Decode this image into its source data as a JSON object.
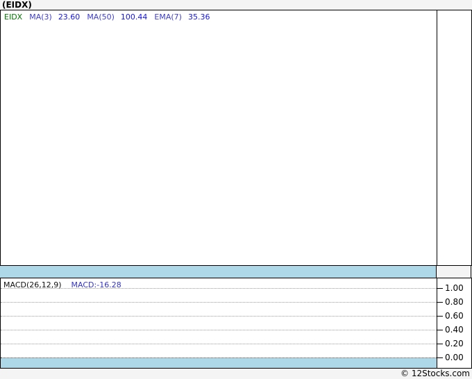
{
  "page": {
    "title": "(EIDX)",
    "footer_credit": "© 12Stocks.com"
  },
  "colors": {
    "background": "#f4f4f4",
    "panel_background": "#ffffff",
    "border": "#000000",
    "band_blue": "#aed7e8",
    "symbol_green": "#007700",
    "indicator_label_blue": "#3d3dcc",
    "indicator_value_blue": "#1414e6",
    "macd_value_blue": "#3333cc",
    "gridline_gray": "#999999"
  },
  "price_panel": {
    "legend": {
      "symbol": "EIDX",
      "indicators": [
        {
          "label": "MA(3)",
          "value": "23.60"
        },
        {
          "label": "MA(50)",
          "value": "100.44"
        },
        {
          "label": "EMA(7)",
          "value": "35.36"
        }
      ]
    }
  },
  "macd_panel": {
    "label": "MACD(26,12,9)",
    "value": "MACD:-16.28",
    "yticks": [
      "1.00",
      "0.80",
      "0.60",
      "0.40",
      "0.20",
      "0.00"
    ]
  },
  "chart_data": [
    {
      "type": "line",
      "title": "(EIDX)",
      "series": [
        {
          "name": "EIDX",
          "color": "#007700",
          "values": []
        },
        {
          "name": "MA(3)",
          "last_value": 23.6,
          "values": []
        },
        {
          "name": "MA(50)",
          "last_value": 100.44,
          "values": []
        },
        {
          "name": "EMA(7)",
          "last_value": 35.36,
          "values": []
        }
      ],
      "grid": "off",
      "note": "price plot area is empty (no line/candle pixels rendered in screenshot)"
    },
    {
      "type": "line",
      "title": "MACD(26,12,9)",
      "series": [
        {
          "name": "MACD",
          "last_value": -16.28,
          "values": []
        }
      ],
      "yticks": [
        1.0,
        0.8,
        0.6,
        0.4,
        0.2,
        0.0
      ],
      "ylim": [
        0.0,
        1.0
      ],
      "legend_position": "top-left",
      "grid": "dotted horizontal gridlines",
      "note": "indicator plot area is empty (no MACD line rendered in screenshot)"
    }
  ]
}
